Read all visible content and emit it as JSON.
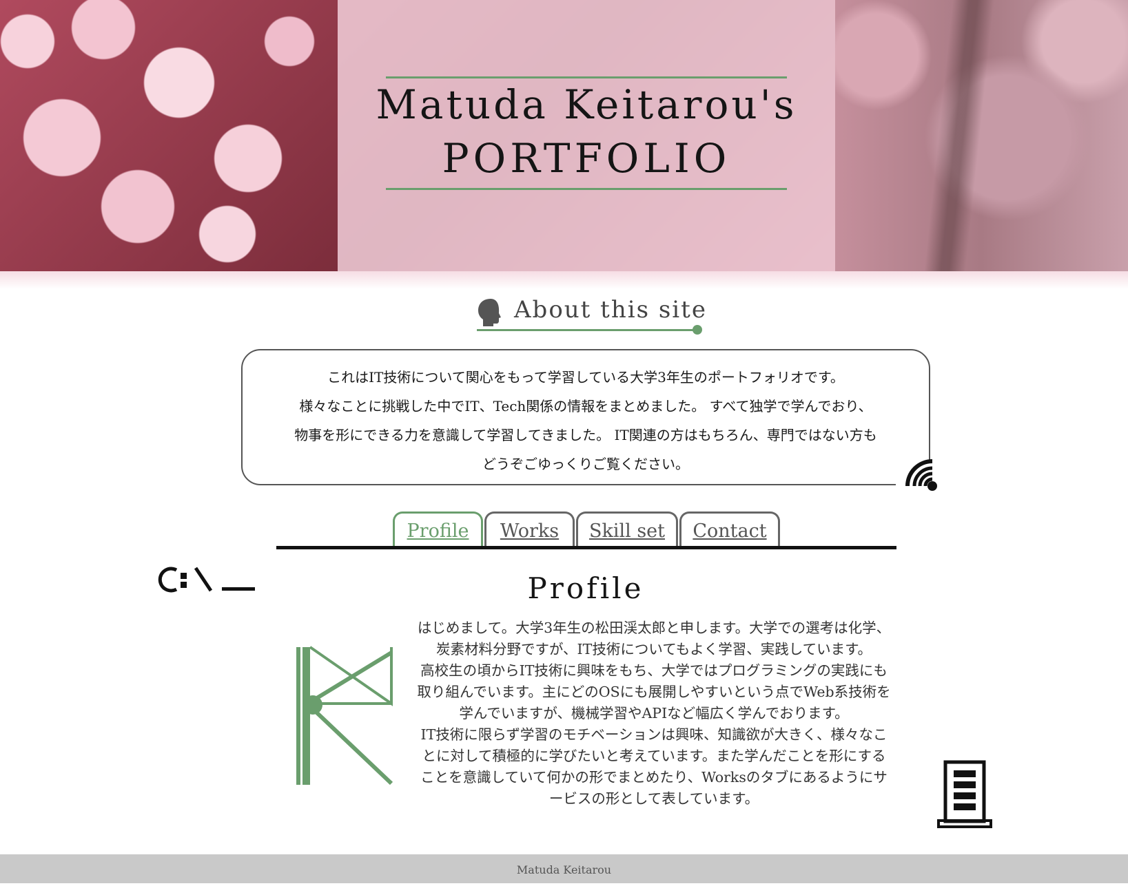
{
  "hero": {
    "title_line1": "Matuda Keitarou's",
    "title_line2": "PORTFOLIO"
  },
  "about": {
    "heading": "About this site",
    "lines": [
      "これはIT技術について関心をもって学習している大学3年生のポートフォリオです。",
      "様々なことに挑戦した中でIT、Tech関係の情報をまとめました。 すべて独学で学んでおり、",
      "物事を形にできる力を意識して学習してきました。 IT関連の方はもちろん、専門ではない方も",
      "どうぞごゆっくりご覧ください。"
    ]
  },
  "tabs": [
    {
      "label": "Profile",
      "active": true
    },
    {
      "label": "Works",
      "active": false
    },
    {
      "label": "Skill set",
      "active": false
    },
    {
      "label": "Contact",
      "active": false
    }
  ],
  "profile": {
    "title": "Profile",
    "lines": [
      "はじめまして。大学3年生の松田渓太郎と申します。大学での選考は化学、",
      "炭素材料分野ですが、IT技術についてもよく学習、実践しています。",
      "高校生の頃からIT技術に興味をもち、大学ではプログラミングの実践にも",
      "取り組んでいます。主にどのOSにも展開しやすいという点でWeb系技術を",
      "学んでいますが、機械学習やAPIなど幅広く学んでおります。",
      "IT技術に限らず学習のモチベーションは興味、知識欲が大きく、様々なこ",
      "とに対して積極的に学びたいと考えています。また学んだことを形にする",
      "ことを意識していて何かの形でまとめたり、Worksのタブにあるようにサ",
      "ービスの形として表しています。"
    ]
  },
  "footer": {
    "text": "Matuda Keitarou"
  },
  "colors": {
    "accent": "#6a9e6d",
    "footer_bg": "#c9c9c9",
    "hero_overlay": "#f6d5e0"
  },
  "icons": [
    "head-silhouette-icon",
    "wifi-icon",
    "command-prompt-icon",
    "k-logo-icon",
    "server-icon"
  ]
}
